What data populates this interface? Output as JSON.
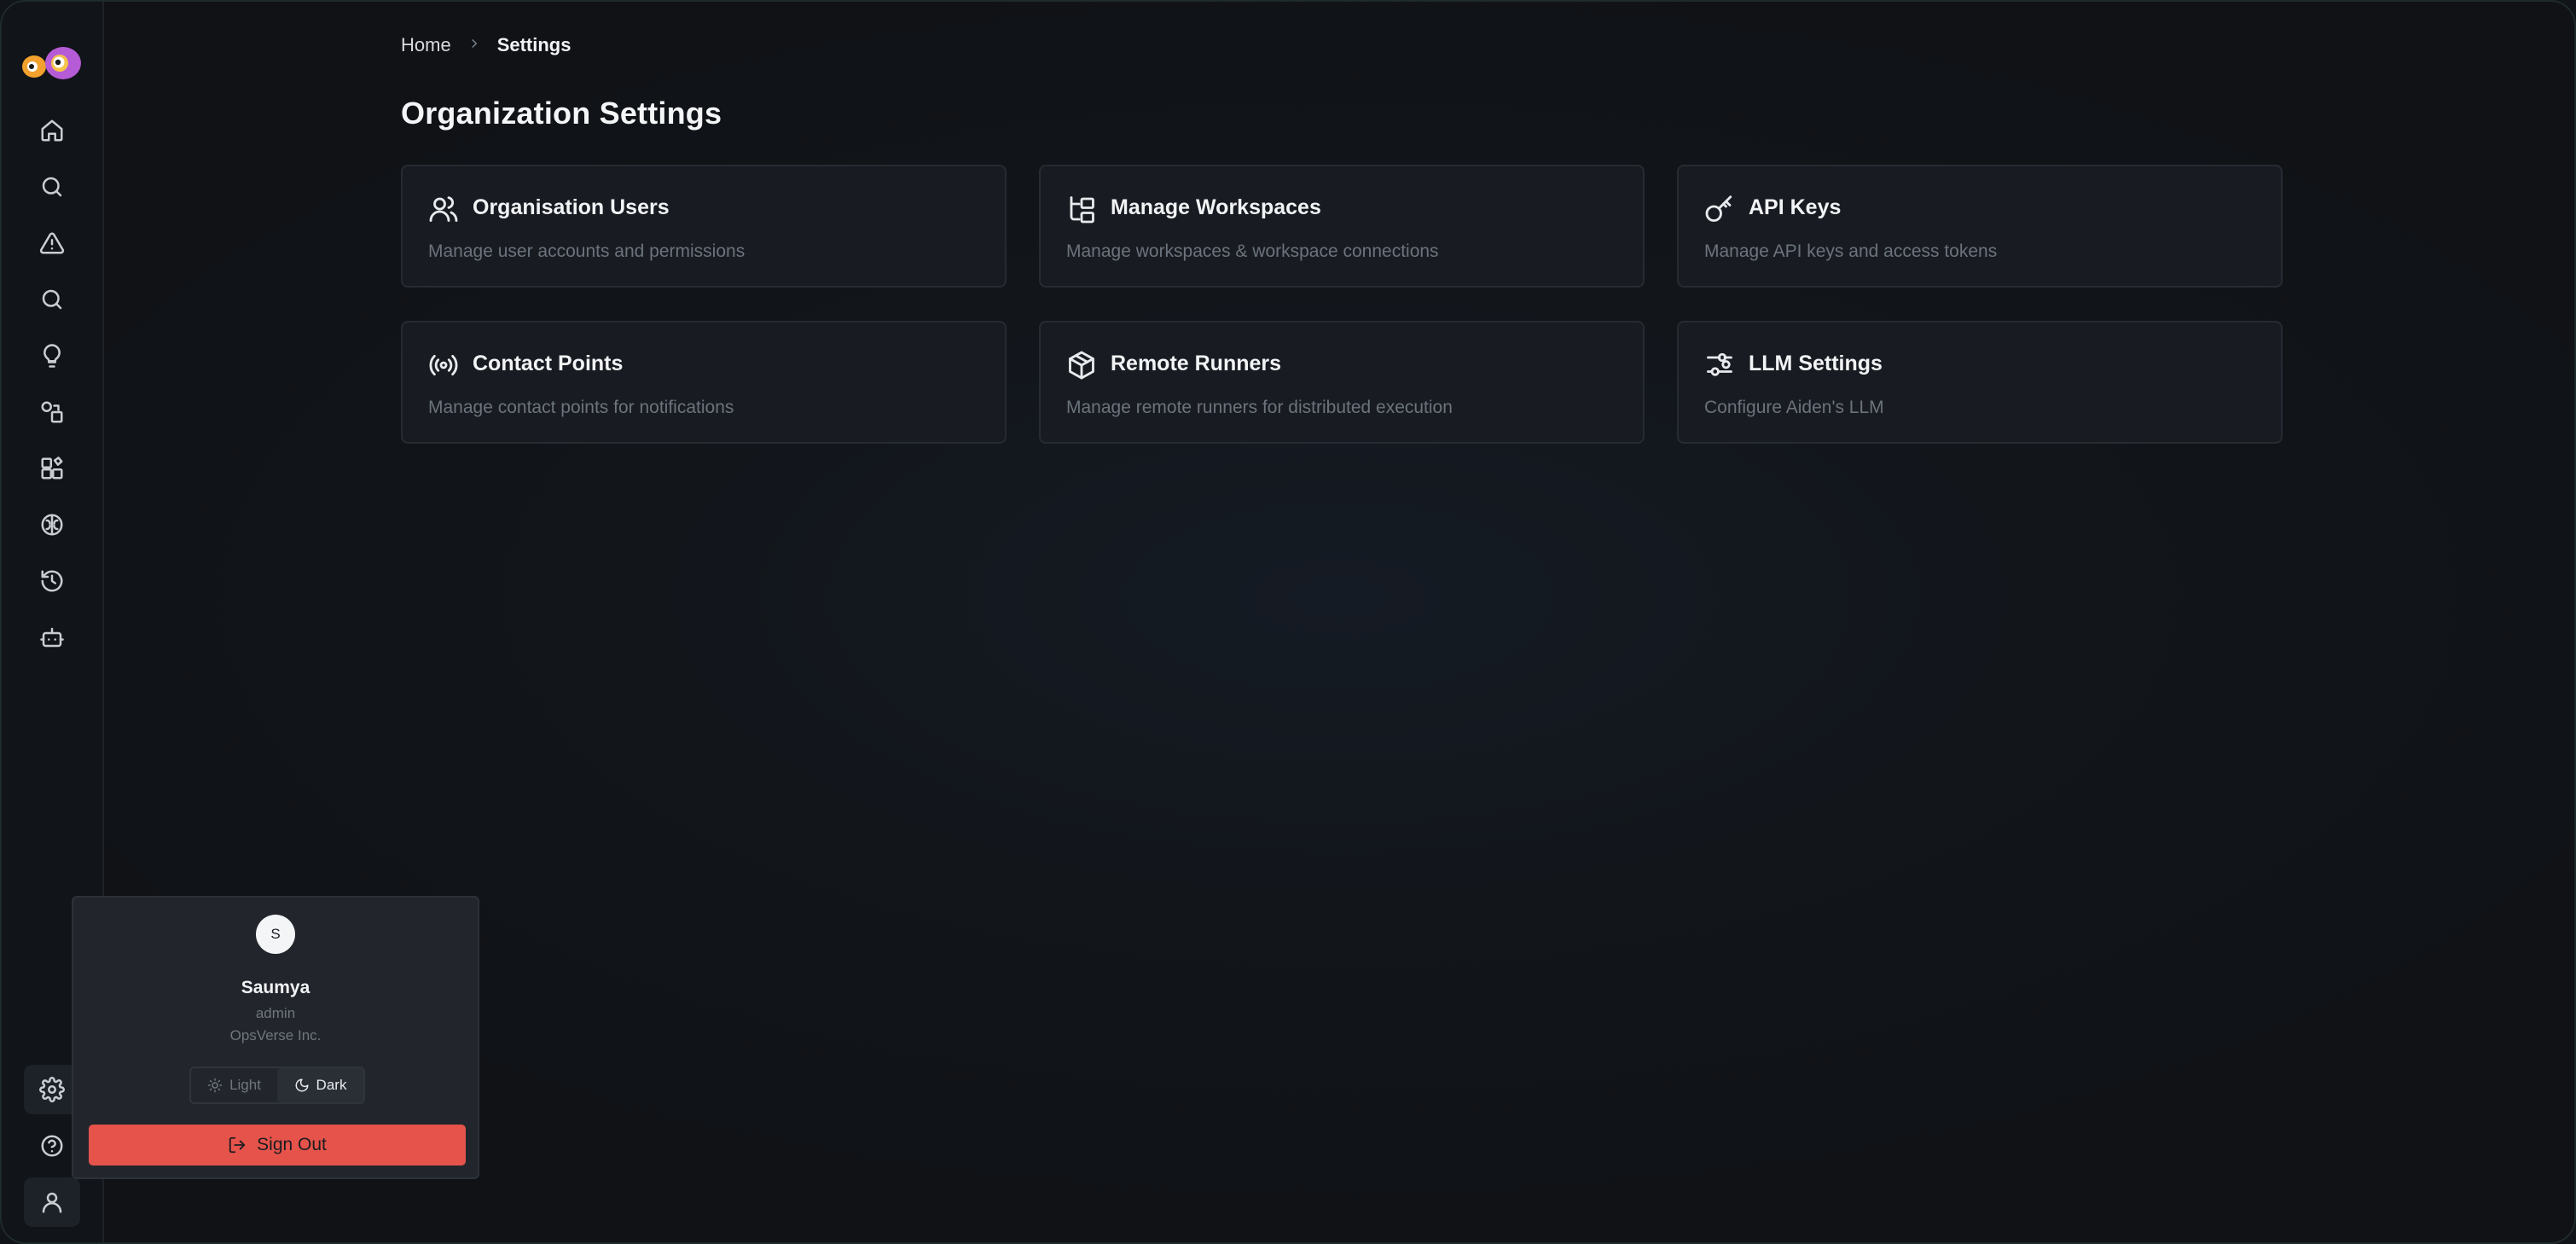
{
  "breadcrumb": {
    "home": "Home",
    "current": "Settings"
  },
  "page": {
    "title": "Organization Settings"
  },
  "cards": [
    {
      "title": "Organisation Users",
      "desc": "Manage user accounts and permissions",
      "icon": "users-icon"
    },
    {
      "title": "Manage Workspaces",
      "desc": "Manage workspaces & workspace connections",
      "icon": "folder-tree-icon"
    },
    {
      "title": "API Keys",
      "desc": "Manage API keys and access tokens",
      "icon": "key-icon"
    },
    {
      "title": "Contact Points",
      "desc": "Manage contact points for notifications",
      "icon": "radio-broadcast-icon"
    },
    {
      "title": "Remote Runners",
      "desc": "Manage remote runners for distributed execution",
      "icon": "package-icon"
    },
    {
      "title": "LLM Settings",
      "desc": "Configure Aiden's LLM",
      "icon": "sliders-icon"
    }
  ],
  "sidebar": {
    "items": [
      {
        "icon": "home-icon"
      },
      {
        "icon": "search-icon"
      },
      {
        "icon": "alert-triangle-icon"
      },
      {
        "icon": "search-icon"
      },
      {
        "icon": "lightbulb-icon"
      },
      {
        "icon": "shapes-icon"
      },
      {
        "icon": "dashboard-blocks-icon"
      },
      {
        "icon": "brain-icon"
      },
      {
        "icon": "history-icon"
      },
      {
        "icon": "bot-icon"
      }
    ],
    "bottom": [
      {
        "icon": "gear-icon"
      },
      {
        "icon": "help-circle-icon"
      },
      {
        "icon": "user-icon"
      }
    ]
  },
  "user_menu": {
    "avatar_initial": "S",
    "name": "Saumya",
    "role": "admin",
    "org": "OpsVerse Inc.",
    "theme_light_label": "Light",
    "theme_dark_label": "Dark",
    "theme_selected": "Dark",
    "sign_out_label": "Sign Out"
  },
  "colors": {
    "background": "#111418",
    "card_bg": "#181c22",
    "sign_out": "#e5534b"
  }
}
